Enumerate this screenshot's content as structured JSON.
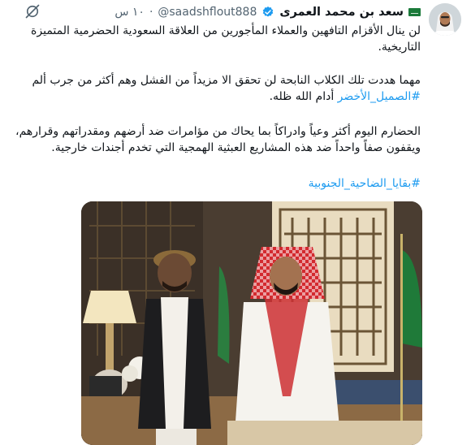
{
  "tweet": {
    "author_name": "سعد بن محمد العمرى",
    "handle": "@saadshflout888",
    "separator": "·",
    "time": "١٠ س",
    "paragraph_1": "لن ينال الأقزام التافهين والعملاء المأجورين من العلاقة السعودية الحضرمية المتميزة التاريخية.",
    "paragraph_2_text": "مهما هددت تلك الكلاب النابحة لن تحقق الا مزيداً من الفشل وهم أكثر من جرب ألم",
    "paragraph_2_hashtag": "#الصميل_الأخضر",
    "paragraph_2_suffix": " أدام الله ظله.",
    "paragraph_3": "الحضارم اليوم أكثر وعياً وادراكاً بما يحاك من مؤامرات ضد أرضهم ومقدراتهم وقرارهم، ويقفون صفاً واحداً ضد هذه المشاريع العبثية الهمجية التي تخدم أجندات خارجية.",
    "paragraph_4_hashtag": "#بقايا_الضاحية_الجنوبية"
  },
  "icons": {
    "flag": "saudi-flag-icon",
    "verified": "verified-badge-icon",
    "grok": "grok-icon"
  },
  "colors": {
    "link": "#1d9bf0",
    "verified": "#1d9bf0",
    "text": "#0f1419",
    "muted": "#536471"
  }
}
